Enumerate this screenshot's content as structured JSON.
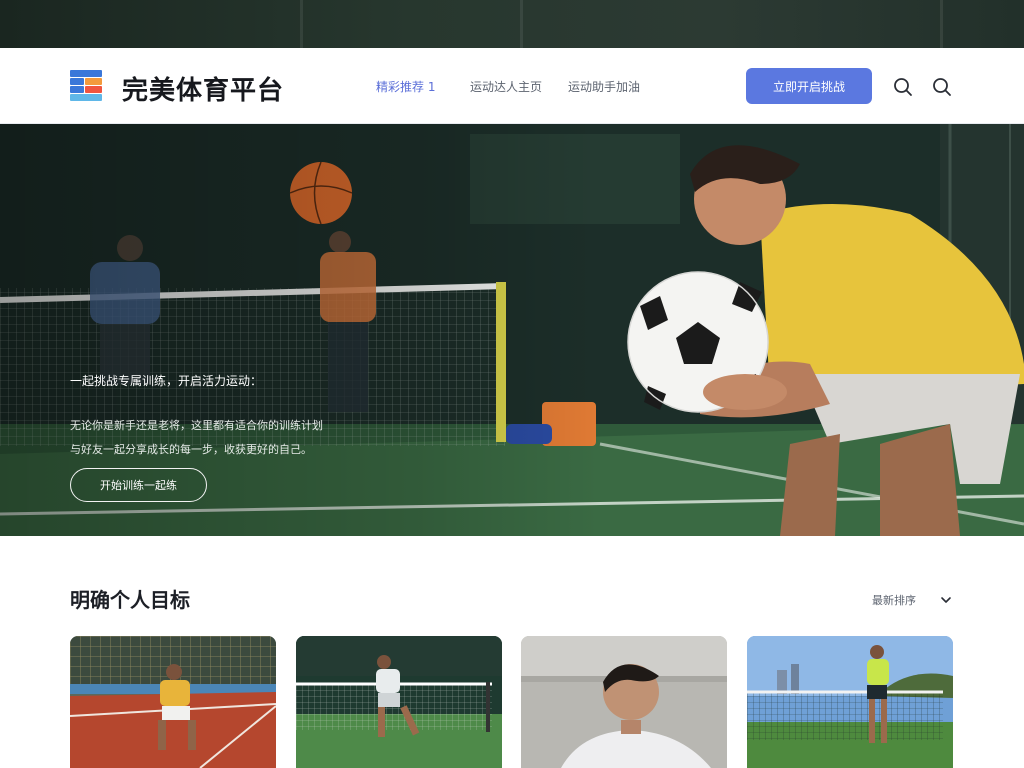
{
  "brand": {
    "name": "完美体育平台",
    "logo_colors": [
      "#3a77d9",
      "#f39a3c",
      "#f0553f",
      "#5fb7e8"
    ]
  },
  "nav": {
    "links": [
      {
        "label": "精彩推荐 1",
        "active": true
      },
      {
        "label": "运动达人主页",
        "active": false
      },
      {
        "label": "运动助手加油",
        "active": false
      }
    ],
    "cta_label": "立即开启挑战",
    "icons": [
      "search-icon",
      "search-icon"
    ]
  },
  "hero": {
    "headline": "一起挑战专属训练，开启活力运动：",
    "description_lines": [
      "无论你是新手还是老将，这里都有适合你的训练计划",
      "与好友一起分享成长的每一步，收获更好的自己。"
    ],
    "button_label": "开始训练一起练"
  },
  "section": {
    "title": "明确个人目标",
    "sort_label": "最新排序",
    "sort_icon": "chevron-down-icon"
  },
  "cards": [
    {
      "name": "card-clay-court-player"
    },
    {
      "name": "card-tennis-net-player"
    },
    {
      "name": "card-portrait-athlete"
    },
    {
      "name": "card-outdoor-tennis-player"
    }
  ],
  "colors": {
    "accent": "#5b78e0",
    "active_link": "#5b6fd8",
    "hero_text": "#ffffff"
  }
}
